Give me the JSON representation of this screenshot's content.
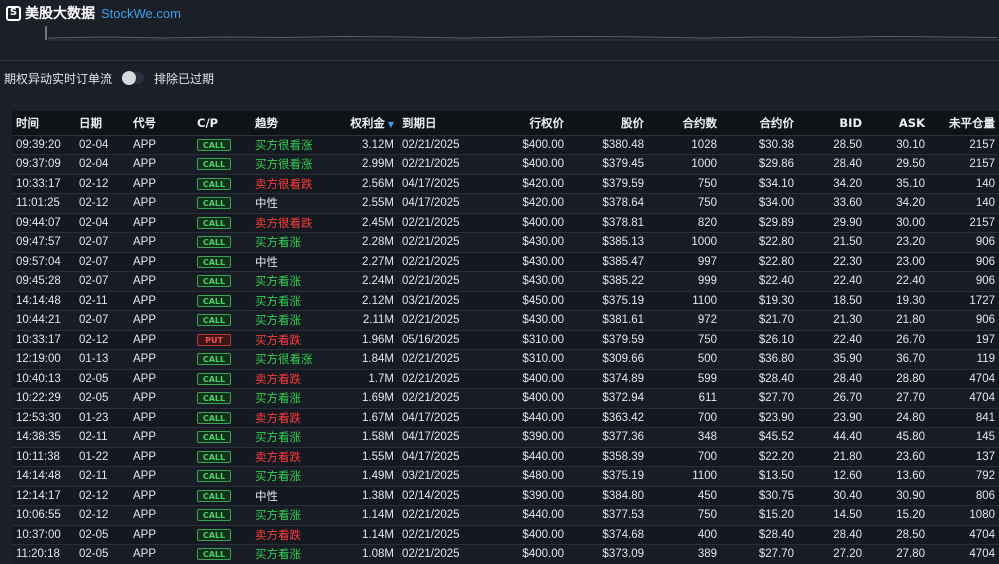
{
  "brand": {
    "logo_glyph": "S",
    "name": "美股大数据",
    "site": "StockWe.com"
  },
  "filters": {
    "title": "期权异动实时订单流",
    "toggle_on": false,
    "toggle_label": "排除已过期"
  },
  "colors": {
    "bullish": "#2fd04f",
    "bearish": "#ff3b3b",
    "neutral": "#e4e7ec",
    "accent": "#3aa0e8"
  },
  "table": {
    "sort_icon": "caret-down-icon",
    "headers": [
      "时间",
      "日期",
      "代号",
      "C/P",
      "趋势",
      "权利金",
      "到期日",
      "行权价",
      "股价",
      "合约数",
      "合约价",
      "BID",
      "ASK",
      "未平仓量"
    ],
    "rows": [
      {
        "time": "09:39:20",
        "date": "02-04",
        "symbol": "APP",
        "cp": "CALL",
        "trend": "买方很看涨",
        "trend_color": "#2fd04f",
        "premium": "3.12M",
        "expiry": "02/21/2025",
        "strike": "$400.00",
        "stock": "$380.48",
        "contracts": "1028",
        "price": "$30.38",
        "bid": "28.50",
        "ask": "30.10",
        "oi": "2157"
      },
      {
        "time": "09:37:09",
        "date": "02-04",
        "symbol": "APP",
        "cp": "CALL",
        "trend": "买方很看涨",
        "trend_color": "#2fd04f",
        "premium": "2.99M",
        "expiry": "02/21/2025",
        "strike": "$400.00",
        "stock": "$379.45",
        "contracts": "1000",
        "price": "$29.86",
        "bid": "28.40",
        "ask": "29.50",
        "oi": "2157"
      },
      {
        "time": "10:33:17",
        "date": "02-12",
        "symbol": "APP",
        "cp": "CALL",
        "trend": "卖方很看跌",
        "trend_color": "#ff3b3b",
        "premium": "2.56M",
        "expiry": "04/17/2025",
        "strike": "$420.00",
        "stock": "$379.59",
        "contracts": "750",
        "price": "$34.10",
        "bid": "34.20",
        "ask": "35.10",
        "oi": "140"
      },
      {
        "time": "11:01:25",
        "date": "02-12",
        "symbol": "APP",
        "cp": "CALL",
        "trend": "中性",
        "trend_color": "#e4e7ec",
        "premium": "2.55M",
        "expiry": "04/17/2025",
        "strike": "$420.00",
        "stock": "$378.64",
        "contracts": "750",
        "price": "$34.00",
        "bid": "33.60",
        "ask": "34.20",
        "oi": "140"
      },
      {
        "time": "09:44:07",
        "date": "02-04",
        "symbol": "APP",
        "cp": "CALL",
        "trend": "卖方很看跌",
        "trend_color": "#ff3b3b",
        "premium": "2.45M",
        "expiry": "02/21/2025",
        "strike": "$400.00",
        "stock": "$378.81",
        "contracts": "820",
        "price": "$29.89",
        "bid": "29.90",
        "ask": "30.00",
        "oi": "2157"
      },
      {
        "time": "09:47:57",
        "date": "02-07",
        "symbol": "APP",
        "cp": "CALL",
        "trend": "买方看涨",
        "trend_color": "#2fd04f",
        "premium": "2.28M",
        "expiry": "02/21/2025",
        "strike": "$430.00",
        "stock": "$385.13",
        "contracts": "1000",
        "price": "$22.80",
        "bid": "21.50",
        "ask": "23.20",
        "oi": "906"
      },
      {
        "time": "09:57:04",
        "date": "02-07",
        "symbol": "APP",
        "cp": "CALL",
        "trend": "中性",
        "trend_color": "#e4e7ec",
        "premium": "2.27M",
        "expiry": "02/21/2025",
        "strike": "$430.00",
        "stock": "$385.47",
        "contracts": "997",
        "price": "$22.80",
        "bid": "22.30",
        "ask": "23.00",
        "oi": "906"
      },
      {
        "time": "09:45:28",
        "date": "02-07",
        "symbol": "APP",
        "cp": "CALL",
        "trend": "买方看涨",
        "trend_color": "#2fd04f",
        "premium": "2.24M",
        "expiry": "02/21/2025",
        "strike": "$430.00",
        "stock": "$385.22",
        "contracts": "999",
        "price": "$22.40",
        "bid": "22.40",
        "ask": "22.40",
        "oi": "906"
      },
      {
        "time": "14:14:48",
        "date": "02-11",
        "symbol": "APP",
        "cp": "CALL",
        "trend": "买方看涨",
        "trend_color": "#2fd04f",
        "premium": "2.12M",
        "expiry": "03/21/2025",
        "strike": "$450.00",
        "stock": "$375.19",
        "contracts": "1100",
        "price": "$19.30",
        "bid": "18.50",
        "ask": "19.30",
        "oi": "1727"
      },
      {
        "time": "10:44:21",
        "date": "02-07",
        "symbol": "APP",
        "cp": "CALL",
        "trend": "买方看涨",
        "trend_color": "#2fd04f",
        "premium": "2.11M",
        "expiry": "02/21/2025",
        "strike": "$430.00",
        "stock": "$381.61",
        "contracts": "972",
        "price": "$21.70",
        "bid": "21.30",
        "ask": "21.80",
        "oi": "906"
      },
      {
        "time": "10:33:17",
        "date": "02-12",
        "symbol": "APP",
        "cp": "PUT",
        "trend": "买方看跌",
        "trend_color": "#ff3b3b",
        "premium": "1.96M",
        "expiry": "05/16/2025",
        "strike": "$310.00",
        "stock": "$379.59",
        "contracts": "750",
        "price": "$26.10",
        "bid": "22.40",
        "ask": "26.70",
        "oi": "197"
      },
      {
        "time": "12:19:00",
        "date": "01-13",
        "symbol": "APP",
        "cp": "CALL",
        "trend": "买方很看涨",
        "trend_color": "#2fd04f",
        "premium": "1.84M",
        "expiry": "02/21/2025",
        "strike": "$310.00",
        "stock": "$309.66",
        "contracts": "500",
        "price": "$36.80",
        "bid": "35.90",
        "ask": "36.70",
        "oi": "119"
      },
      {
        "time": "10:40:13",
        "date": "02-05",
        "symbol": "APP",
        "cp": "CALL",
        "trend": "卖方看跌",
        "trend_color": "#ff3b3b",
        "premium": "1.7M",
        "expiry": "02/21/2025",
        "strike": "$400.00",
        "stock": "$374.89",
        "contracts": "599",
        "price": "$28.40",
        "bid": "28.40",
        "ask": "28.80",
        "oi": "4704"
      },
      {
        "time": "10:22:29",
        "date": "02-05",
        "symbol": "APP",
        "cp": "CALL",
        "trend": "买方看涨",
        "trend_color": "#2fd04f",
        "premium": "1.69M",
        "expiry": "02/21/2025",
        "strike": "$400.00",
        "stock": "$372.94",
        "contracts": "611",
        "price": "$27.70",
        "bid": "26.70",
        "ask": "27.70",
        "oi": "4704"
      },
      {
        "time": "12:53:30",
        "date": "01-23",
        "symbol": "APP",
        "cp": "CALL",
        "trend": "卖方看跌",
        "trend_color": "#ff3b3b",
        "premium": "1.67M",
        "expiry": "04/17/2025",
        "strike": "$440.00",
        "stock": "$363.42",
        "contracts": "700",
        "price": "$23.90",
        "bid": "23.90",
        "ask": "24.80",
        "oi": "841"
      },
      {
        "time": "14:38:35",
        "date": "02-11",
        "symbol": "APP",
        "cp": "CALL",
        "trend": "买方看涨",
        "trend_color": "#2fd04f",
        "premium": "1.58M",
        "expiry": "04/17/2025",
        "strike": "$390.00",
        "stock": "$377.36",
        "contracts": "348",
        "price": "$45.52",
        "bid": "44.40",
        "ask": "45.80",
        "oi": "145"
      },
      {
        "time": "10:11:38",
        "date": "01-22",
        "symbol": "APP",
        "cp": "CALL",
        "trend": "卖方看跌",
        "trend_color": "#ff3b3b",
        "premium": "1.55M",
        "expiry": "04/17/2025",
        "strike": "$440.00",
        "stock": "$358.39",
        "contracts": "700",
        "price": "$22.20",
        "bid": "21.80",
        "ask": "23.60",
        "oi": "137"
      },
      {
        "time": "14:14:48",
        "date": "02-11",
        "symbol": "APP",
        "cp": "CALL",
        "trend": "买方看涨",
        "trend_color": "#2fd04f",
        "premium": "1.49M",
        "expiry": "03/21/2025",
        "strike": "$480.00",
        "stock": "$375.19",
        "contracts": "1100",
        "price": "$13.50",
        "bid": "12.60",
        "ask": "13.60",
        "oi": "792"
      },
      {
        "time": "12:14:17",
        "date": "02-12",
        "symbol": "APP",
        "cp": "CALL",
        "trend": "中性",
        "trend_color": "#e4e7ec",
        "premium": "1.38M",
        "expiry": "02/14/2025",
        "strike": "$390.00",
        "stock": "$384.80",
        "contracts": "450",
        "price": "$30.75",
        "bid": "30.40",
        "ask": "30.90",
        "oi": "806"
      },
      {
        "time": "10:06:55",
        "date": "02-12",
        "symbol": "APP",
        "cp": "CALL",
        "trend": "买方看涨",
        "trend_color": "#2fd04f",
        "premium": "1.14M",
        "expiry": "02/21/2025",
        "strike": "$440.00",
        "stock": "$377.53",
        "contracts": "750",
        "price": "$15.20",
        "bid": "14.50",
        "ask": "15.20",
        "oi": "1080"
      },
      {
        "time": "10:37:00",
        "date": "02-05",
        "symbol": "APP",
        "cp": "CALL",
        "trend": "卖方看跌",
        "trend_color": "#ff3b3b",
        "premium": "1.14M",
        "expiry": "02/21/2025",
        "strike": "$400.00",
        "stock": "$374.68",
        "contracts": "400",
        "price": "$28.40",
        "bid": "28.40",
        "ask": "28.50",
        "oi": "4704"
      },
      {
        "time": "11:20:18",
        "date": "02-05",
        "symbol": "APP",
        "cp": "CALL",
        "trend": "买方看涨",
        "trend_color": "#2fd04f",
        "premium": "1.08M",
        "expiry": "02/21/2025",
        "strike": "$400.00",
        "stock": "$373.09",
        "contracts": "389",
        "price": "$27.70",
        "bid": "27.20",
        "ask": "27.80",
        "oi": "4704"
      }
    ]
  }
}
